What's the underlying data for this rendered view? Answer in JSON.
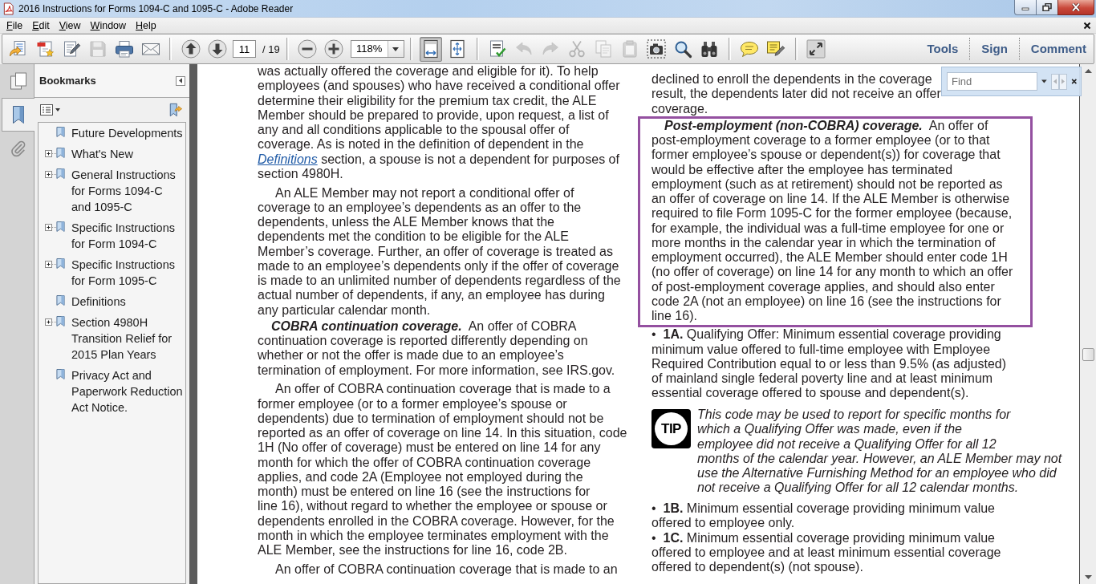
{
  "window": {
    "title": "2016 Instructions for Forms 1094-C and 1095-C - Adobe Reader"
  },
  "menu": {
    "items": [
      "File",
      "Edit",
      "View",
      "Window",
      "Help"
    ]
  },
  "toolbar": {
    "groups": [
      [
        {
          "kind": "create",
          "disabled": false
        },
        {
          "kind": "convert",
          "disabled": false
        },
        {
          "kind": "sign",
          "disabled": false
        },
        {
          "kind": "save",
          "disabled": true
        },
        {
          "kind": "print",
          "disabled": false
        },
        {
          "kind": "email",
          "disabled": false
        }
      ],
      [
        {
          "kind": "up",
          "disabled": false
        },
        {
          "kind": "down",
          "disabled": false
        },
        {
          "kind": "page",
          "value": "11",
          "total": "/ 19"
        }
      ],
      [
        {
          "kind": "zoomout",
          "disabled": false
        },
        {
          "kind": "zoomin",
          "disabled": false
        },
        {
          "kind": "zoom",
          "value": "118%"
        }
      ],
      [
        {
          "kind": "fitwidth",
          "selected": true
        },
        {
          "kind": "fitpage",
          "selected": false
        }
      ],
      [
        {
          "kind": "spell",
          "disabled": false
        },
        {
          "kind": "undo",
          "disabled": true
        },
        {
          "kind": "redo",
          "disabled": true
        },
        {
          "kind": "cut",
          "disabled": true
        },
        {
          "kind": "copy",
          "disabled": true
        },
        {
          "kind": "paste",
          "disabled": true
        },
        {
          "kind": "snapshot",
          "disabled": false
        },
        {
          "kind": "search",
          "disabled": false
        },
        {
          "kind": "find",
          "disabled": false
        }
      ],
      [
        {
          "kind": "comment",
          "disabled": false
        },
        {
          "kind": "highlight",
          "disabled": false
        }
      ],
      [
        {
          "kind": "fullscreen",
          "disabled": false
        }
      ]
    ],
    "panes": [
      "Tools",
      "Sign",
      "Comment"
    ]
  },
  "navigation": {
    "tabs": [
      {
        "kind": "pages",
        "selected": false
      },
      {
        "kind": "bookmarks",
        "selected": true
      },
      {
        "kind": "attachments",
        "selected": false
      }
    ]
  },
  "bookmarks": {
    "title": "Bookmarks",
    "items": [
      {
        "label": "Future Developments",
        "has_children": false,
        "expanded": false
      },
      {
        "label": "What's New",
        "has_children": true,
        "expanded": false
      },
      {
        "label": "General Instructions for Forms 1094-C and 1095-C",
        "has_children": true,
        "expanded": false
      },
      {
        "label": "Specific Instructions for Form 1094-C",
        "has_children": true,
        "expanded": false
      },
      {
        "label": "Specific Instructions for Form 1095-C",
        "has_children": true,
        "expanded": false
      },
      {
        "label": "Definitions",
        "has_children": false,
        "expanded": false
      },
      {
        "label": "Section 4980H Transition Relief for 2015 Plan Years",
        "has_children": true,
        "expanded": false
      },
      {
        "label": "Privacy Act and Paperwork Reduction Act Notice.",
        "has_children": false,
        "expanded": false
      }
    ]
  },
  "find": {
    "placeholder": "Find",
    "buttons": [
      {
        "kind": "previous",
        "disabled": true
      },
      {
        "kind": "next",
        "disabled": true
      }
    ]
  },
  "document": {
    "left_column": [
      {
        "kind": "continued",
        "lines": [
          "was actually offered the coverage and eligible for it). To help",
          "employees (and spouses) who have received a conditional offer",
          "determine their eligibility for the premium tax credit, the ALE",
          "Member should be prepared to provide, upon request, a list of",
          "any and all conditions applicable to the spousal offer of",
          "coverage. As is noted in the definition of dependent in the",
          {
            "link": "Definitions",
            "after": " section, a spouse is not a dependent for purposes of"
          },
          "section 4980H."
        ]
      },
      {
        "kind": "text",
        "lines": [
          "An ALE Member may not report a conditional offer of",
          "coverage to an employee’s dependents as an offer to the",
          "dependents, unless the ALE Member knows that the",
          "dependents met the condition to be eligible for the ALE",
          "Member’s coverage. Further, an offer of coverage is treated as",
          "made to an employee’s dependents only if the offer of coverage",
          "is made to an unlimited number of dependents regardless of the",
          "actual number of dependents, if any, an employee has during",
          "any particular calendar month."
        ]
      },
      {
        "kind": "runin",
        "lines": [
          "**COBRA continuation coverage.**  An offer of COBRA",
          "continuation coverage is reported differently depending on",
          "whether or not the offer is made due to an employee’s",
          "termination of employment. For more information, see IRS.gov."
        ]
      },
      {
        "kind": "text",
        "lines": [
          "An offer of COBRA continuation coverage that is made to a",
          "former employee (or to a former employee’s spouse or",
          "dependents) due to termination of employment should not be",
          "reported as an offer of coverage on line 14. In this situation, code",
          "1H (No offer of coverage) must be entered on line 14 for any",
          "month for which the offer of COBRA continuation coverage",
          "applies, and code 2A (Employee not employed during the",
          "month) must be entered on line 16 (see the instructions for",
          "line 16), without regard to whether the employee or spouse or",
          "dependents enrolled in the COBRA coverage. However, for the",
          "month in which the employee terminates employment with the",
          "ALE Member, see the instructions for line 16, code 2B."
        ]
      },
      {
        "kind": "text",
        "lines": [
          "An offer of COBRA continuation coverage that is made to an"
        ]
      }
    ],
    "right_column": [
      {
        "kind": "continued",
        "lines": [
          "declined to enroll the dependents in the coverage",
          "result, the dependents later did not receive an offer",
          "coverage."
        ]
      },
      {
        "kind": "box",
        "paragraphs": [
          {
            "kind": "runin",
            "lines": [
              "**Post-employment (non-COBRA) coverage.**  An offer of",
              "post-employment coverage to a former employee (or to that",
              "former employee’s spouse or dependent(s)) for coverage that",
              "would be effective after the employee has terminated",
              "employment (such as at retirement) should not be reported as",
              "an offer of coverage on line 14. If the ALE Member is otherwise",
              "required to file Form 1095-C for the former employee (because,",
              "for example, the individual was a full-time employee for one or",
              "more months in the calendar year in which the termination of",
              "employment occurred), the ALE Member should enter code 1H",
              "(no offer of coverage) on line 14 for any month to which an offer",
              "of post-employment coverage applies, and should also enter",
              "code 2A (not an employee) on line 16 (see the instructions for",
              "line 16)."
            ]
          }
        ]
      },
      {
        "kind": "bullet",
        "lines": [
          "•  **1A.** Qualifying Offer: Minimum essential coverage providing",
          "minimum value offered to full-time employee with Employee",
          "Required Contribution equal to or less than 9.5% (as adjusted)",
          "of mainland single federal poverty line and at least minimum",
          "essential coverage offered to spouse and dependent(s)."
        ]
      },
      {
        "kind": "tip",
        "badge": "TIP",
        "lines": [
          "This code may be used to report for specific months for",
          "which a Qualifying Offer was made, even if the",
          "employee did not receive a Qualifying Offer for all 12",
          "months of the calendar year. However, an ALE Member may not",
          "use the Alternative Furnishing Method for an employee who did",
          "not receive a Qualifying Offer for all 12 calendar months."
        ]
      },
      {
        "kind": "bullet",
        "lines": [
          "•  **1B.** Minimum essential coverage providing minimum value",
          "offered to employee only."
        ]
      },
      {
        "kind": "bullet",
        "lines": [
          "•  **1C.** Minimum essential coverage providing minimum value",
          "offered to employee and at least minimum essential coverage",
          "offered to dependent(s) (not spouse)."
        ]
      }
    ]
  }
}
